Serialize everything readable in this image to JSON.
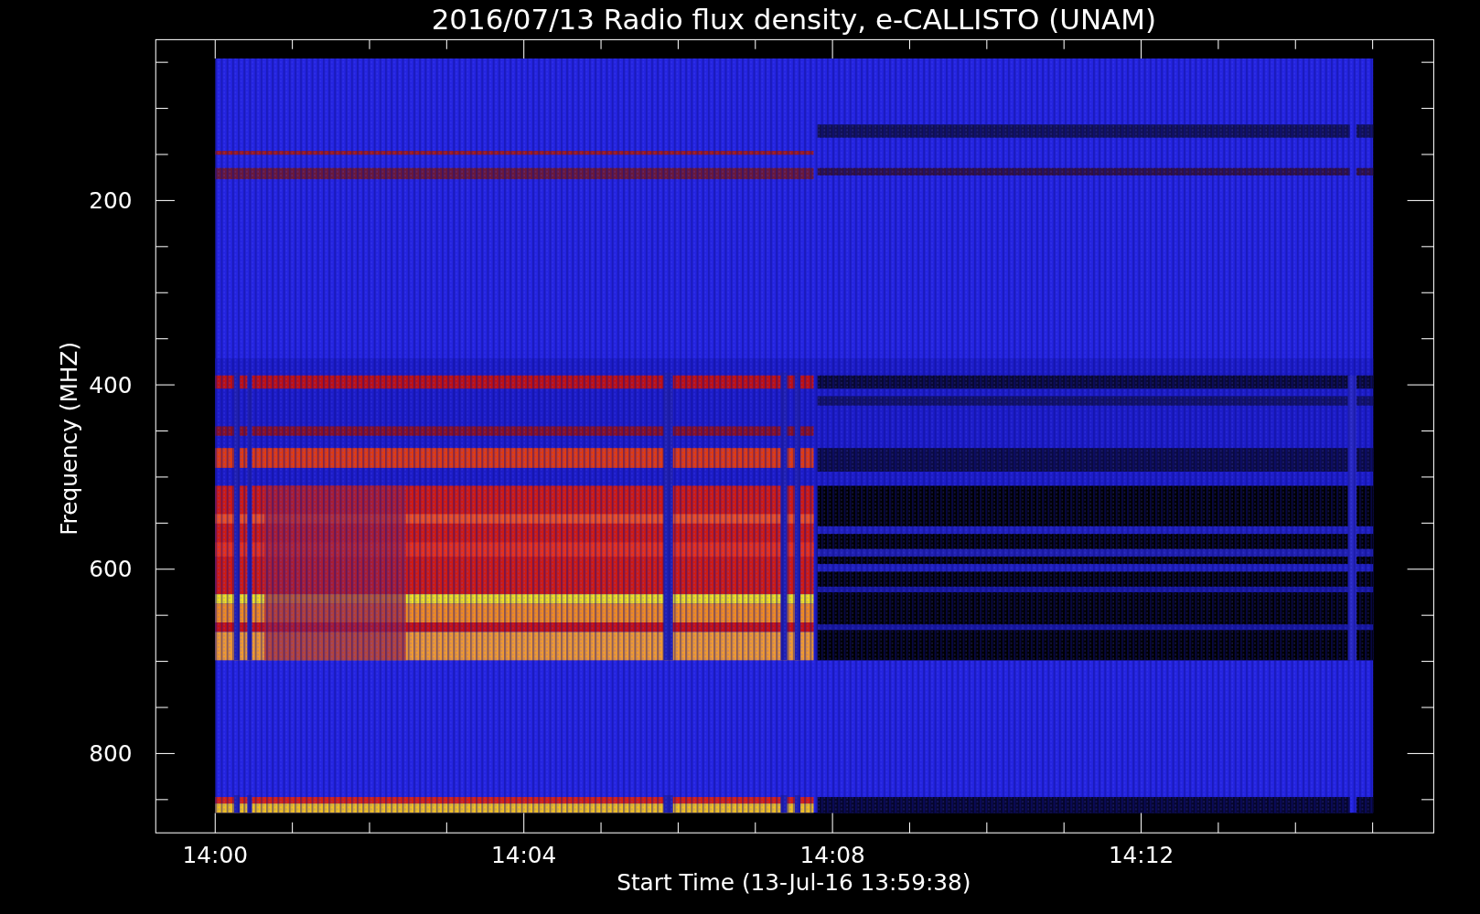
{
  "title": "2016/07/13  Radio flux density, e-CALLISTO (UNAM)",
  "y_axis": {
    "label": "Frequency (MHZ)",
    "ticks": [
      "200",
      "400",
      "600",
      "800"
    ]
  },
  "x_axis": {
    "label": "Start Time (13-Jul-16 13:59:38)",
    "ticks": [
      "14:00",
      "14:04",
      "14:08",
      "14:12"
    ]
  }
}
